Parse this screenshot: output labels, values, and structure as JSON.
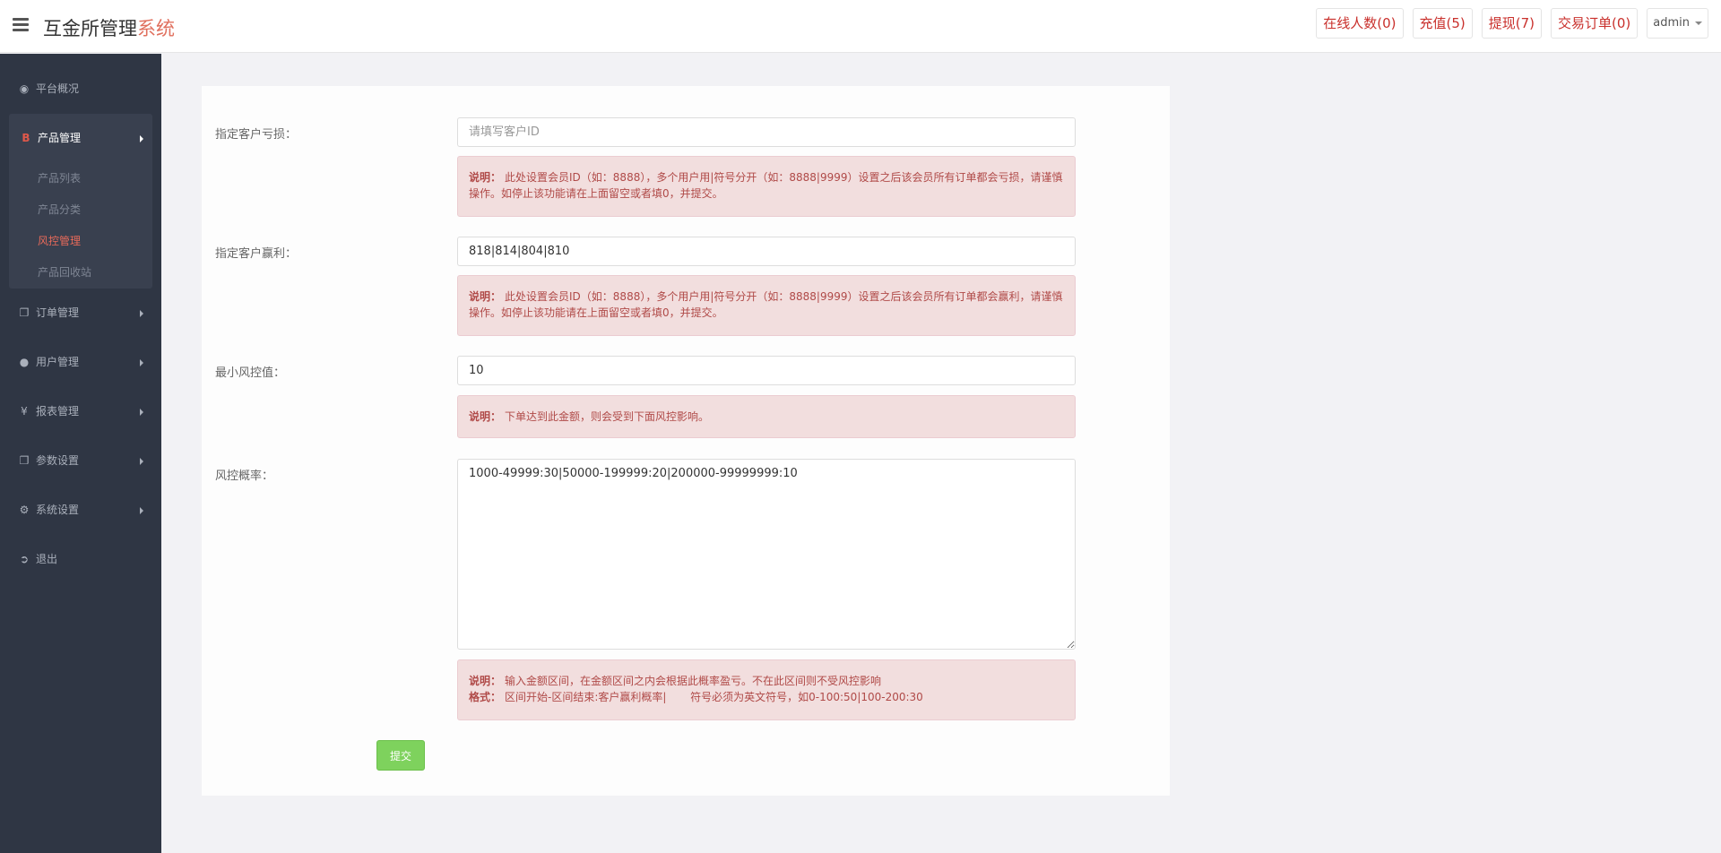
{
  "header": {
    "brand_main": "互金所管理",
    "brand_accent": "系统",
    "nav": {
      "online": "在线人数(0)",
      "recharge": "充值(5)",
      "withdraw": "提现(7)",
      "orders": "交易订单(0)",
      "user": "admin"
    }
  },
  "sidebar": {
    "overview": "平台概况",
    "product_mgmt": "产品管理",
    "sub_items": [
      "产品列表",
      "产品分类",
      "风控管理",
      "产品回收站"
    ],
    "order_mgmt": "订单管理",
    "user_mgmt": "用户管理",
    "report_mgmt": "报表管理",
    "param_settings": "参数设置",
    "system_settings": "系统设置",
    "logout": "退出"
  },
  "form": {
    "loss_label": "指定客户亏损：",
    "loss_placeholder": "请填写客户ID",
    "loss_value": "",
    "loss_note_title": "说明：",
    "loss_note": "此处设置会员ID（如：8888），多个用户用|符号分开（如：8888|9999）设置之后该会员所有订单都会亏损，请谨慎操作。如停止该功能请在上面留空或者填0，并提交。",
    "profit_label": "指定客户赢利：",
    "profit_value": "818|814|804|810",
    "profit_note_title": "说明：",
    "profit_note": "此处设置会员ID（如：8888），多个用户用|符号分开（如：8888|9999）设置之后该会员所有订单都会赢利，请谨慎操作。如停止该功能请在上面留空或者填0，并提交。",
    "min_label": "最小风控值：",
    "min_value": "10",
    "min_note_title": "说明：",
    "min_note": "下单达到此金额，则会受到下面风控影响。",
    "prob_label": "风控概率：",
    "prob_value": "1000-49999:30|50000-199999:20|200000-99999999:10",
    "prob_note_title": "说明：",
    "prob_note": "输入金额区间，在金额区间之内会根据此概率盈亏。不在此区间则不受风控影响",
    "prob_format_title": "格式：",
    "prob_format": "区间开始-区间结束:客户赢利概率|       符号必须为英文符号，如0-100:50|100-200:30",
    "submit_label": "提交"
  },
  "colors": {
    "sidebar_bg": "#2f3644",
    "accent": "#e0705e",
    "alert_bg": "#f2dede",
    "alert_text": "#b04a48",
    "submit_bg": "#7ed25d"
  }
}
